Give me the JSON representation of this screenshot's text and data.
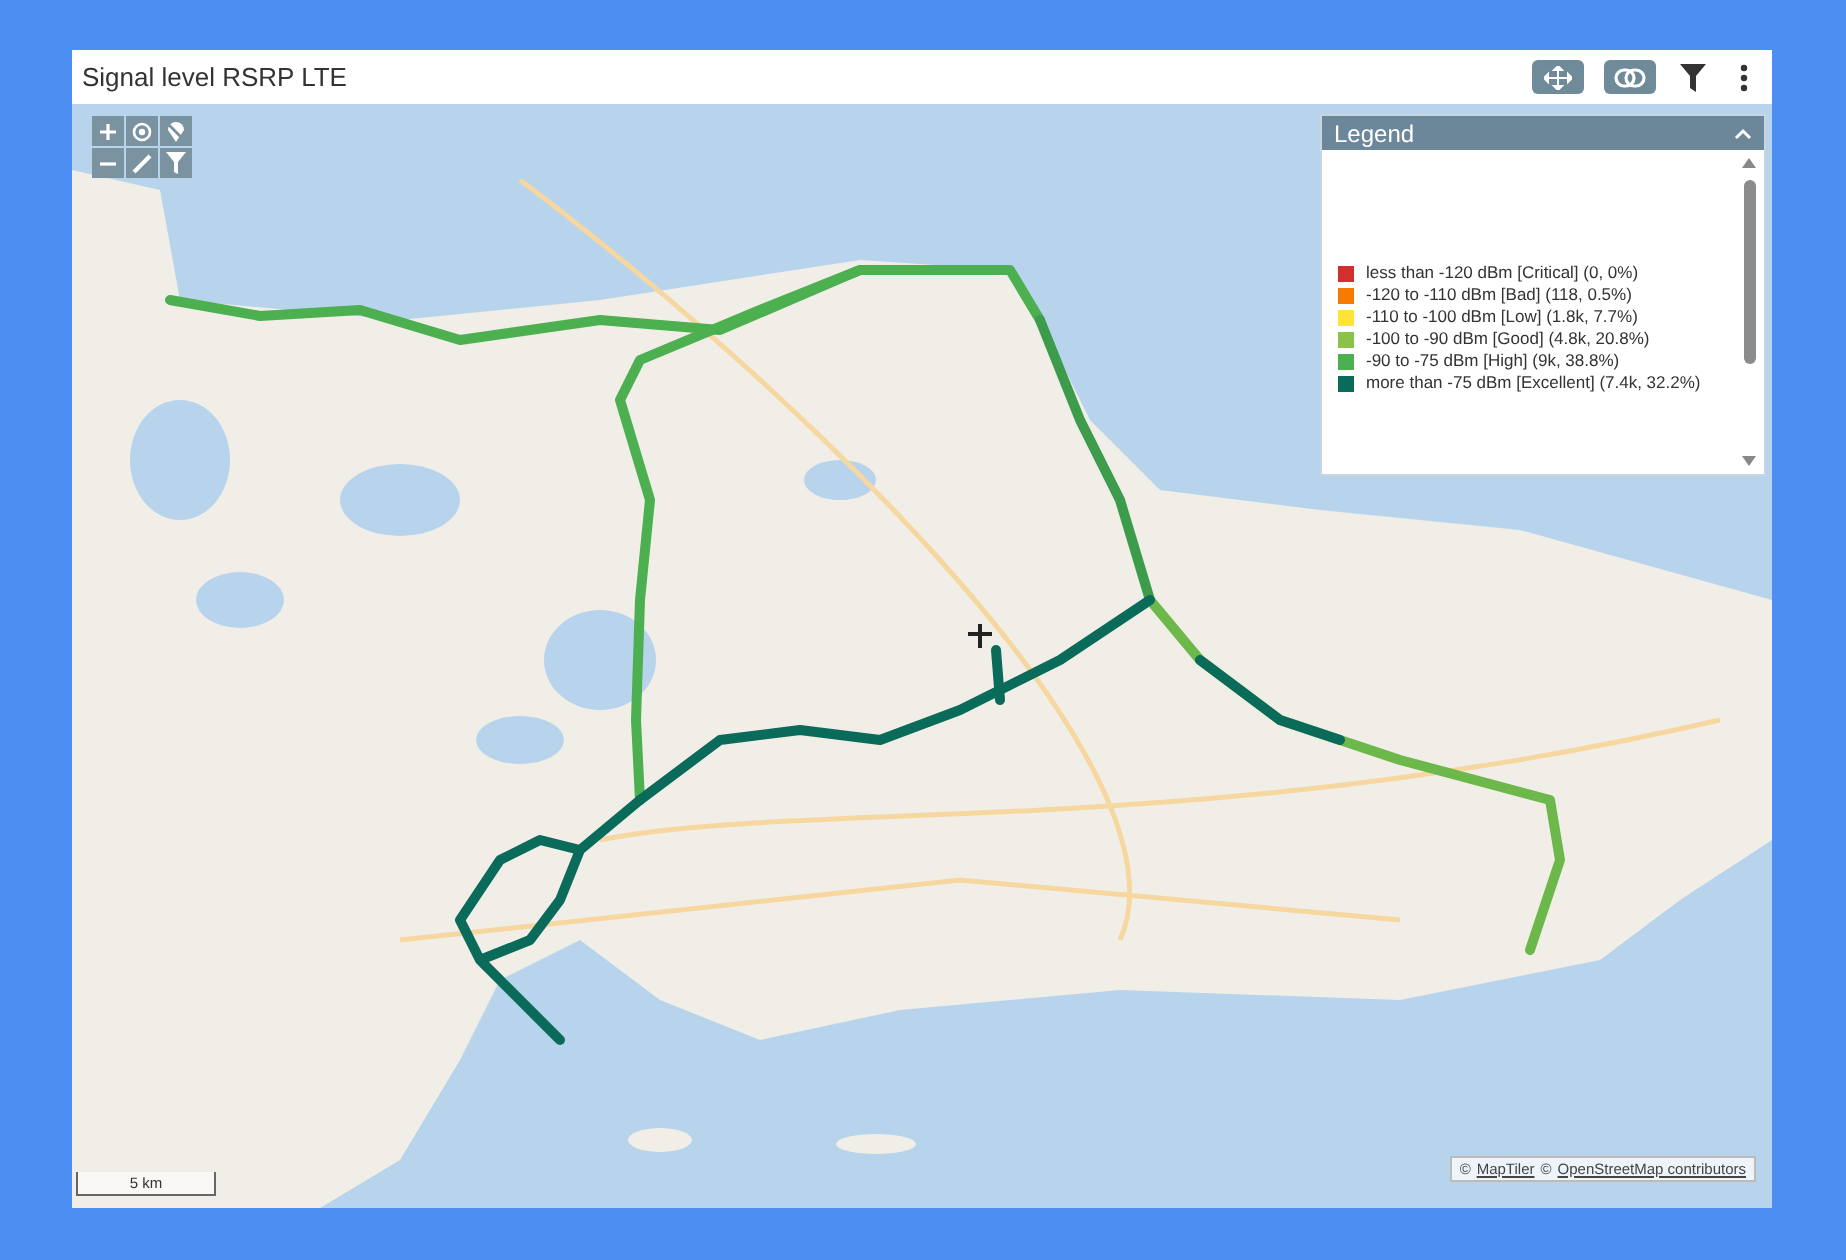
{
  "header": {
    "title": "Signal level RSRP LTE"
  },
  "legend": {
    "title": "Legend",
    "items": [
      {
        "label": "less than -120 dBm [Critical] (0, 0%)",
        "color": "#d32f2f"
      },
      {
        "label": "-120 to -110 dBm [Bad] (118, 0.5%)",
        "color": "#f57c00"
      },
      {
        "label": "-110 to -100 dBm [Low] (1.8k, 7.7%)",
        "color": "#fde33a"
      },
      {
        "label": "-100 to -90 dBm [Good] (4.8k, 20.8%)",
        "color": "#8bc34a"
      },
      {
        "label": "-90 to -75 dBm [High] (9k, 38.8%)",
        "color": "#4caf50"
      },
      {
        "label": "more than -75 dBm [Excellent] (7.4k, 32.2%)",
        "color": "#0b6b5b"
      }
    ]
  },
  "attribution": [
    {
      "symbol": "©",
      "link": "MapTiler"
    },
    {
      "symbol": "©",
      "link": "OpenStreetMap contributors"
    }
  ],
  "scale": {
    "label": "5 km"
  }
}
